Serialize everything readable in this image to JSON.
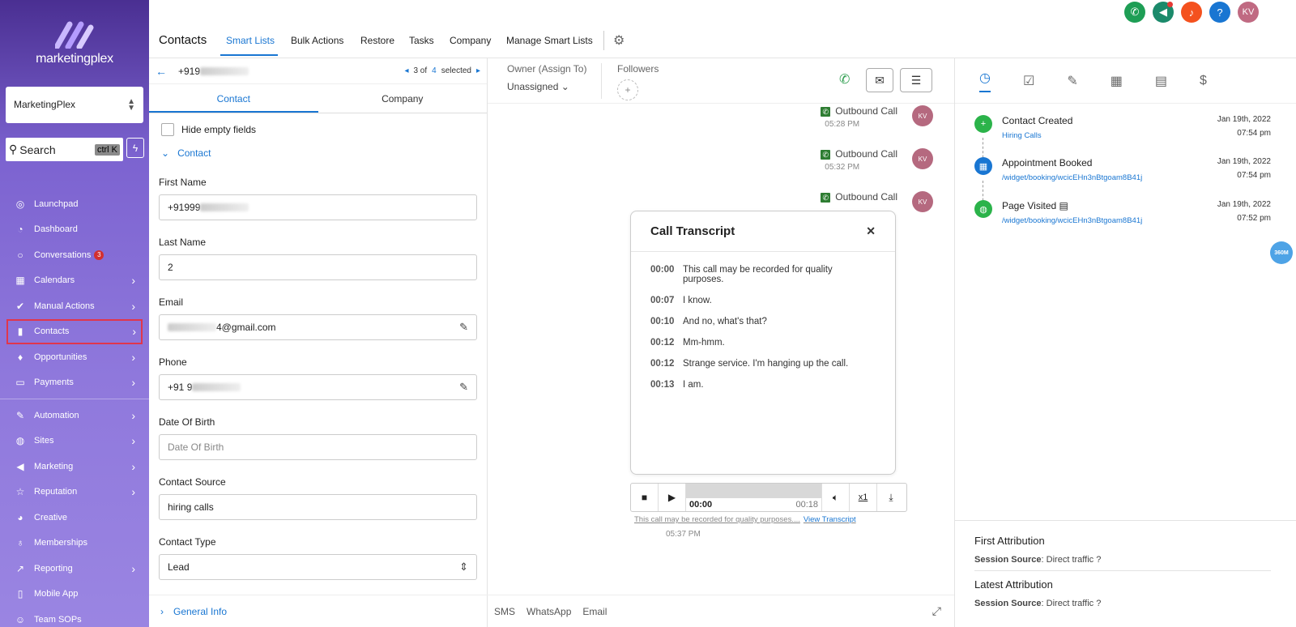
{
  "sidebar": {
    "brand": "marketingplex",
    "account": "MarketingPlex",
    "search_label": "Search",
    "search_shortcut": "ctrl K",
    "items": [
      {
        "label": "Launchpad",
        "icon": "rocket-icon"
      },
      {
        "label": "Dashboard",
        "icon": "dashboard-icon"
      },
      {
        "label": "Conversations",
        "icon": "chat-icon",
        "badge": "3"
      },
      {
        "label": "Calendars",
        "icon": "calendar-icon"
      },
      {
        "label": "Manual Actions",
        "icon": "check-circle-icon"
      },
      {
        "label": "Contacts",
        "icon": "contact-book-icon"
      },
      {
        "label": "Opportunities",
        "icon": "funnel-icon"
      },
      {
        "label": "Payments",
        "icon": "credit-card-icon"
      },
      {
        "label": "Automation",
        "icon": "automation-icon"
      },
      {
        "label": "Sites",
        "icon": "globe-icon"
      },
      {
        "label": "Marketing",
        "icon": "megaphone-icon"
      },
      {
        "label": "Reputation",
        "icon": "star-icon"
      },
      {
        "label": "Creative",
        "icon": "palette-icon"
      },
      {
        "label": "Memberships",
        "icon": "award-icon"
      },
      {
        "label": "Reporting",
        "icon": "chart-icon"
      },
      {
        "label": "Mobile App",
        "icon": "phone-icon"
      },
      {
        "label": "Team SOPs",
        "icon": "team-icon"
      }
    ]
  },
  "topbar": {
    "title": "Contacts",
    "tabs": [
      "Smart Lists",
      "Bulk Actions",
      "Restore",
      "Tasks",
      "Company",
      "Manage Smart Lists"
    ],
    "user_initials": "KV",
    "colors": {
      "call": "#1e9e55",
      "announce": "#1b8a6b",
      "bell": "#f4511e",
      "help": "#1976d2",
      "avatar": "#c06a82"
    }
  },
  "detail": {
    "phone_prefix": "+919",
    "pager": {
      "index": "3 of",
      "total": "4",
      "suffix": "selected"
    },
    "tabs": [
      "Contact",
      "Company"
    ],
    "hide_empty": "Hide empty fields",
    "section": "Contact",
    "fields": {
      "first_name_label": "First Name",
      "first_name": "+91999",
      "last_name_label": "Last Name",
      "last_name": "2",
      "email_label": "Email",
      "email": "4@gmail.com",
      "phone_label": "Phone",
      "phone": "+91 9",
      "dob_label": "Date Of Birth",
      "dob_placeholder": "Date Of Birth",
      "source_label": "Contact Source",
      "source": "hiring calls",
      "type_label": "Contact Type",
      "type": "Lead"
    },
    "general_info": "General Info"
  },
  "middle": {
    "owner_label": "Owner (Assign To)",
    "owner_value": "Unassigned",
    "followers_label": "Followers",
    "calls": [
      {
        "label": "Outbound Call",
        "time": "05:28 PM"
      },
      {
        "label": "Outbound Call",
        "time": "05:32 PM"
      },
      {
        "label": "Outbound Call",
        "time": ""
      }
    ],
    "avatar": "KV",
    "transcript": {
      "title": "Call Transcript",
      "lines": [
        {
          "t": "00:00",
          "text": "This call may be recorded for quality purposes."
        },
        {
          "t": "00:07",
          "text": "I know."
        },
        {
          "t": "00:10",
          "text": "And no, what's that?"
        },
        {
          "t": "00:12",
          "text": "Mm-hmm."
        },
        {
          "t": "00:12",
          "text": "Strange service. I'm hanging up the call."
        },
        {
          "t": "00:13",
          "text": "I am."
        }
      ]
    },
    "player": {
      "current": "00:00",
      "total": "00:18",
      "speed": "x1"
    },
    "note": "This call may be recorded for quality purposes....",
    "view_transcript": "View Transcript",
    "last_time": "05:37 PM",
    "footer_tabs": [
      "SMS",
      "WhatsApp",
      "Email"
    ]
  },
  "right": {
    "events": [
      {
        "title": "Contact Created",
        "sub": "Hiring Calls",
        "date": "Jan 19th, 2022",
        "time": "07:54 pm",
        "color": "#2bb34a"
      },
      {
        "title": "Appointment Booked",
        "sub": "/widget/booking/wcicEHn3nBtgoam8B41j",
        "date": "Jan 19th, 2022",
        "time": "07:54 pm",
        "color": "#1976d2"
      },
      {
        "title": "Page Visited",
        "sub": "/widget/booking/wcicEHn3nBtgoam8B41j",
        "date": "Jan 19th, 2022",
        "time": "07:52 pm",
        "color": "#2bb34a"
      }
    ],
    "badge": "360M",
    "first_attr": "First Attribution",
    "latest_attr": "Latest Attribution",
    "session_label": "Session Source",
    "session_value": ": Direct traffic"
  }
}
